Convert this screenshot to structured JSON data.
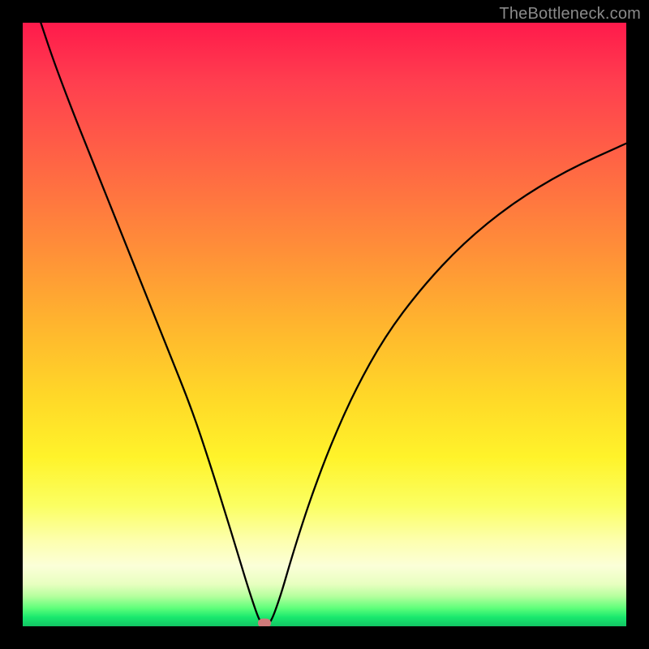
{
  "watermark": "TheBottleneck.com",
  "chart_data": {
    "type": "line",
    "title": "",
    "xlabel": "",
    "ylabel": "",
    "xlim": [
      0,
      100
    ],
    "ylim": [
      0,
      100
    ],
    "series": [
      {
        "name": "bottleneck-curve",
        "x": [
          3,
          5,
          8,
          12,
          16,
          20,
          24,
          28,
          31,
          33.5,
          35.5,
          37,
          38.2,
          39,
          39.6,
          40,
          40.7,
          41.3,
          42,
          43,
          44.3,
          46,
          48,
          51,
          55,
          60,
          66,
          73,
          81,
          90,
          100
        ],
        "y": [
          100,
          94,
          86,
          76,
          66,
          56,
          46,
          36,
          27,
          19,
          12.5,
          7.5,
          3.8,
          1.5,
          0.4,
          0,
          0.3,
          1.2,
          3,
          6,
          10.5,
          16,
          22,
          30,
          39,
          48,
          56,
          63.5,
          70,
          75.5,
          80
        ]
      }
    ],
    "marker": {
      "x": 40.1,
      "y": 0.5
    },
    "gradient_background": {
      "top": "#ff1a4b",
      "mid": "#fff32a",
      "bottom": "#12c564"
    }
  }
}
